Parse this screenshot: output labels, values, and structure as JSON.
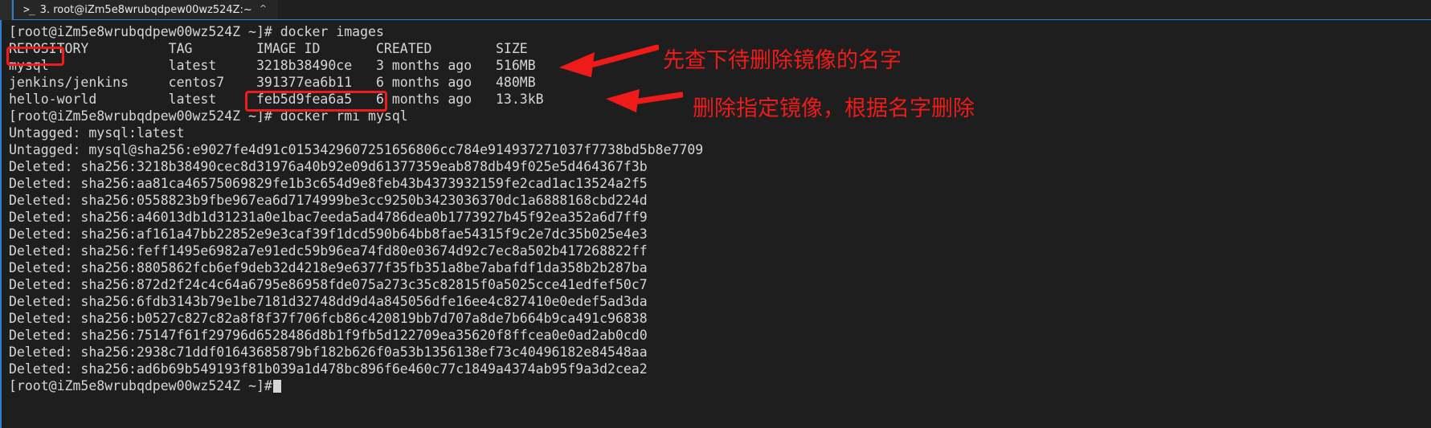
{
  "window": {
    "tab": {
      "icon": "terminal-prompt-icon",
      "label": "3. root@iZm5e8wrubqdpew00wz524Z:~",
      "caret": "^"
    }
  },
  "theme": {
    "terminal_bg": "#1e1e1e",
    "terminal_fg": "#d6d6d6",
    "tab_accent": "#2f7fd1",
    "annotation_red": "#ef1b1b"
  },
  "terminal": {
    "prompt": "[root@iZm5e8wrubqdpew00wz524Z ~]#",
    "lines": [
      "[root@iZm5e8wrubqdpew00wz524Z ~]# docker images",
      "REPOSITORY          TAG        IMAGE ID       CREATED        SIZE",
      "mysql               latest     3218b38490ce   3 months ago   516MB",
      "jenkins/jenkins     centos7    391377ea6b11   6 months ago   480MB",
      "hello-world         latest     feb5d9fea6a5   6 months ago   13.3kB",
      "[root@iZm5e8wrubqdpew00wz524Z ~]# docker rmi mysql",
      "Untagged: mysql:latest",
      "Untagged: mysql@sha256:e9027fe4d91c0153429607251656806cc784e914937271037f7738bd5b8e7709",
      "Deleted: sha256:3218b38490cec8d31976a40b92e09d61377359eab878db49f025e5d464367f3b",
      "Deleted: sha256:aa81ca46575069829fe1b3c654d9e8feb43b4373932159fe2cad1ac13524a2f5",
      "Deleted: sha256:0558823b9fbe967ea6d7174999be3cc9250b3423036370dc1a6888168cbd224d",
      "Deleted: sha256:a46013db1d31231a0e1bac7eeda5ad4786dea0b1773927b45f92ea352a6d7ff9",
      "Deleted: sha256:af161a47bb22852e9e3caf39f1dcd590b64bb8fae54315f9c2e7dc35b025e4e3",
      "Deleted: sha256:feff1495e6982a7e91edc59b96ea74fd80e03674d92c7ec8a502b417268822ff",
      "Deleted: sha256:8805862fcb6ef9deb32d4218e9e6377f35fb351a8be7abafdf1da358b2b287ba",
      "Deleted: sha256:872d2f24c4c64a6795e86958fde075a273c35c82815f0a5025cce41edfef50c7",
      "Deleted: sha256:6fdb3143b79e1be7181d32748dd9d4a845056dfe16ee4c827410e0edef5ad3da",
      "Deleted: sha256:b0527c827c82a8f8f37f706fcb86c420819bb7d707a8de7b664b9ca491c96838",
      "Deleted: sha256:75147f61f29796d6528486d8b1f9fb5d122709ea35620f8ffcea0e0ad2ab0cd0",
      "Deleted: sha256:2938c71ddf01643685879bf182b626f0a53b1356138ef73c40496182e84548aa",
      "Deleted: sha256:ad6b69b549193f81b039a1d478bc896f6e460c77c1849a4374ab95f9a3d2cea2"
    ],
    "last_prompt": "[root@iZm5e8wrubqdpew00wz524Z ~]#",
    "images_table": {
      "columns": [
        "REPOSITORY",
        "TAG",
        "IMAGE ID",
        "CREATED",
        "SIZE"
      ],
      "rows": [
        [
          "mysql",
          "latest",
          "3218b38490ce",
          "3 months ago",
          "516MB"
        ],
        [
          "jenkins/jenkins",
          "centos7",
          "391377ea6b11",
          "6 months ago",
          "480MB"
        ],
        [
          "hello-world",
          "latest",
          "feb5d9fea6a5",
          "6 months ago",
          "13.3kB"
        ]
      ]
    },
    "commands": {
      "images": "docker images",
      "rmi": "docker rmi mysql"
    }
  },
  "annotations": [
    {
      "id": "check-image-name",
      "text": "先查下待删除镜像的名字",
      "arrow": "left-arrow-icon"
    },
    {
      "id": "remove-image-by-name",
      "text": "删除指定镜像，根据名字删除",
      "arrow": "left-arrow-icon"
    }
  ],
  "highlights": [
    {
      "id": "mysql-repository-highlight",
      "target": "mysql"
    },
    {
      "id": "rmi-command-highlight",
      "target": "docker rmi mysql"
    }
  ]
}
